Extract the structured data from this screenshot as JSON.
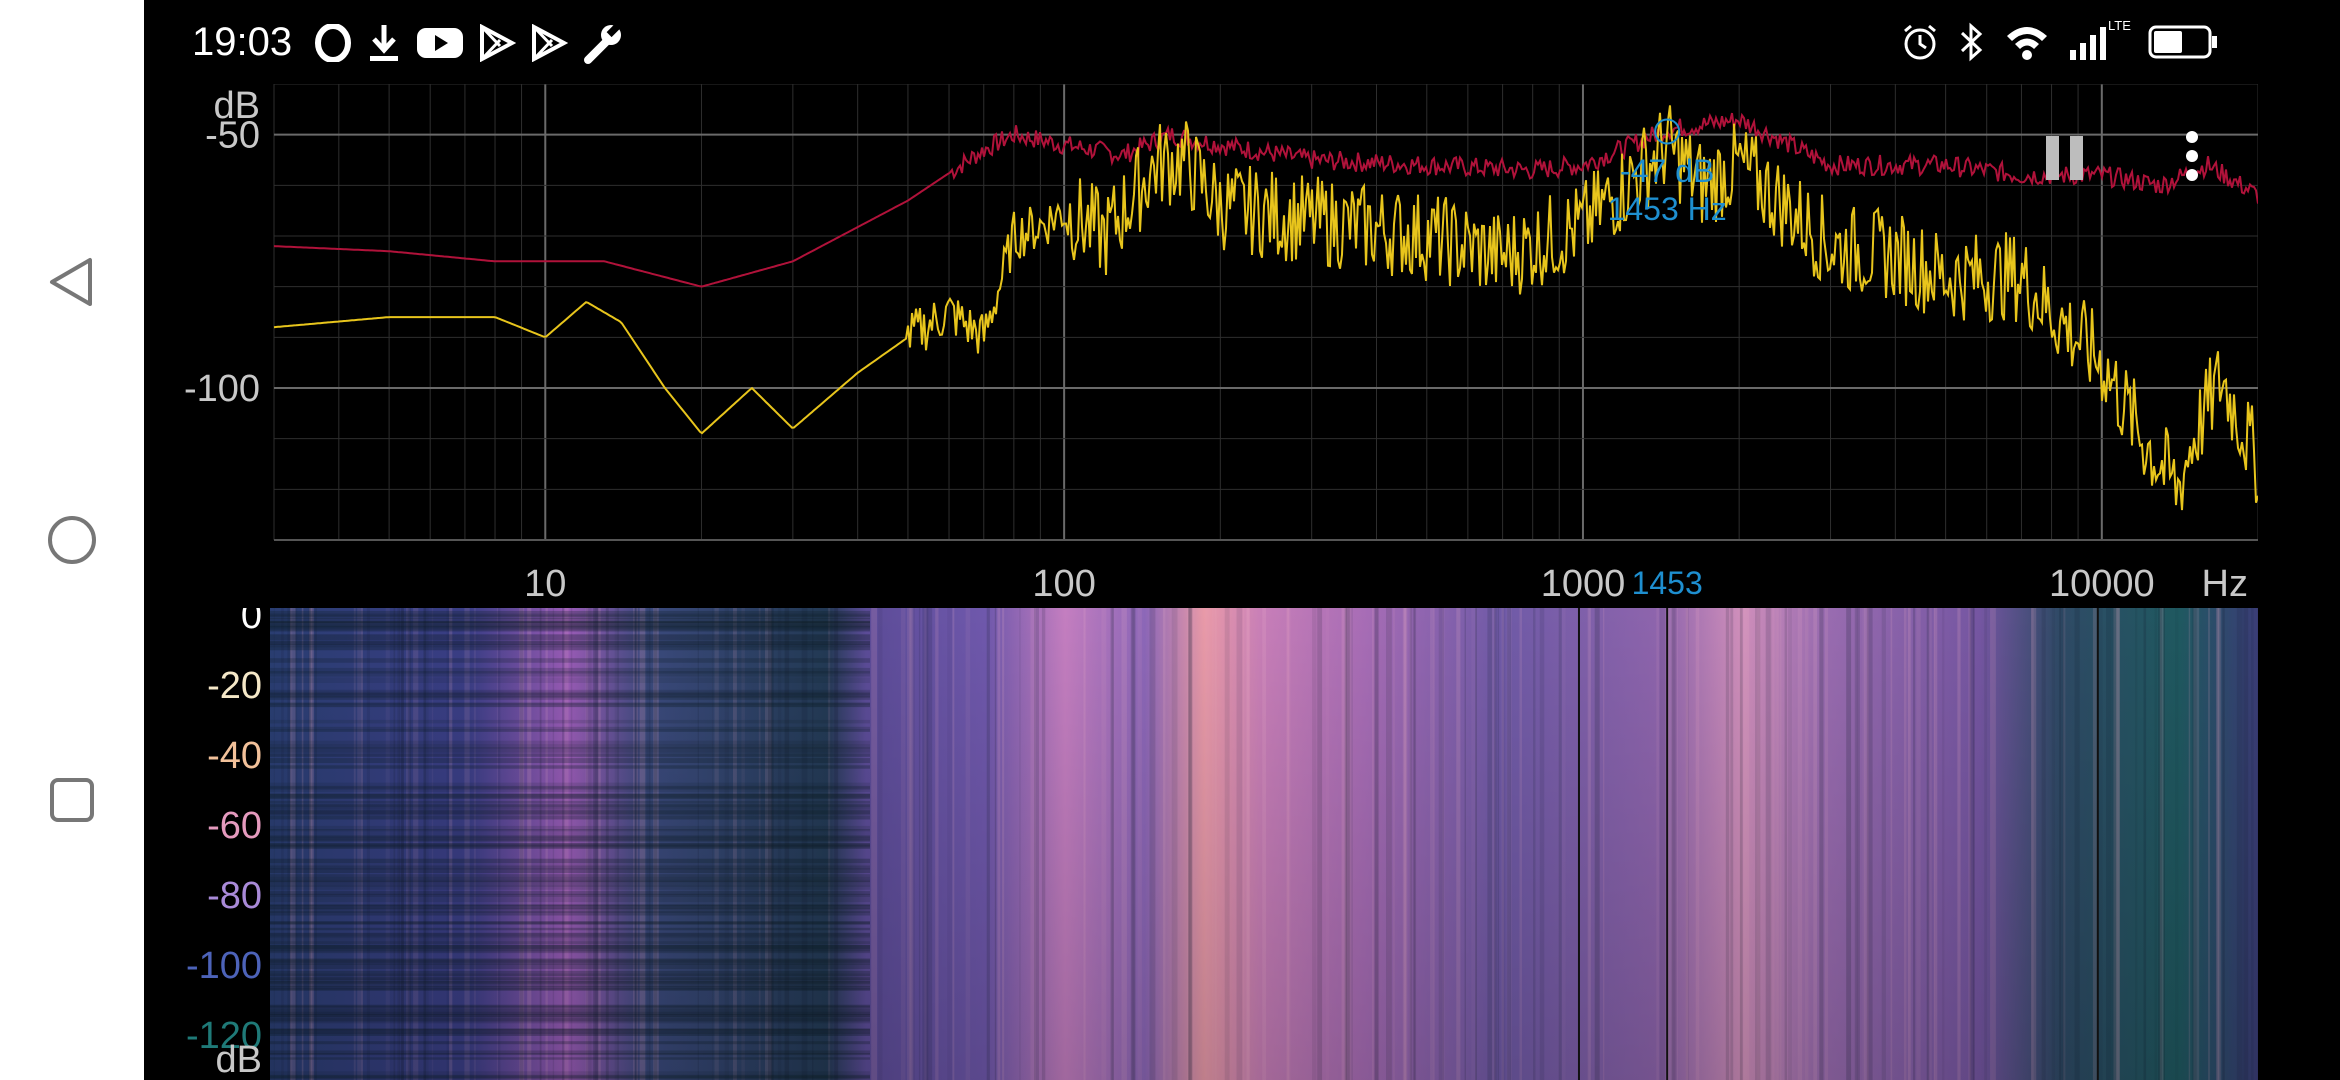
{
  "status_bar": {
    "time": "19:03",
    "left_icons": [
      "opera-icon",
      "download-icon",
      "youtube-icon",
      "play-store-icon",
      "play-store-icon",
      "wrench-icon"
    ],
    "right_icons": [
      "alarm-icon",
      "bluetooth-icon",
      "wifi-icon",
      "cell-signal-icon",
      "battery-icon"
    ],
    "network_type": "LTE"
  },
  "nav_bar": {
    "buttons": [
      "back",
      "home",
      "recents"
    ]
  },
  "spectrum": {
    "y_unit": "dB",
    "x_unit": "Hz",
    "y_ticks": [
      "-50",
      "-100"
    ],
    "x_ticks": [
      "10",
      "100",
      "1000",
      "10000"
    ],
    "cursor": {
      "db_label": "-47 dB",
      "hz_label": "1453 Hz",
      "x_marker_label": "1453"
    },
    "colors": {
      "peak_hold": "#b0123a",
      "live": "#e8c51c",
      "cursor": "#1e8fd0"
    }
  },
  "spectrogram": {
    "y_unit": "dB",
    "y_ticks": [
      "0",
      "-20",
      "-40",
      "-60",
      "-80",
      "-100",
      "-120"
    ],
    "y_tick_colors": [
      "#ffffff",
      "#f5e8c8",
      "#f2c19a",
      "#e59abe",
      "#a98ad8",
      "#4d63b9",
      "#1f7a78"
    ]
  },
  "chart_data": {
    "type": "line",
    "xlabel": "Hz",
    "ylabel": "dB",
    "x_scale": "log",
    "xlim": [
      3,
      20000
    ],
    "ylim": [
      -130,
      -40
    ],
    "series": [
      {
        "x": [
          3,
          5,
          8,
          10,
          13,
          20,
          30,
          50,
          70,
          80,
          100,
          130,
          160,
          200,
          300,
          500,
          800,
          1000,
          1453,
          2000,
          3000,
          5000,
          7000,
          10000,
          13000,
          16000,
          20000
        ],
        "values": [
          -72,
          -73,
          -75,
          -75,
          -75,
          -80,
          -75,
          -63,
          -53,
          -50,
          -52,
          -54,
          -50,
          -52,
          -55,
          -56,
          -57,
          -56,
          -49,
          -47,
          -56,
          -56,
          -58,
          -58,
          -60,
          -56,
          -62
        ]
      },
      {
        "x": [
          3,
          5,
          8,
          10,
          12,
          14,
          17,
          20,
          25,
          30,
          40,
          50,
          60,
          70,
          75,
          80,
          90,
          100,
          120,
          150,
          170,
          200,
          300,
          500,
          700,
          1000,
          1453,
          1700,
          2000,
          3000,
          4000,
          5000,
          7000,
          8000,
          10000,
          12000,
          14000,
          15000,
          17000,
          20000
        ],
        "values": [
          -88,
          -86,
          -86,
          -90,
          -83,
          -87,
          -100,
          -109,
          -100,
          -108,
          -97,
          -90,
          -85,
          -90,
          -80,
          -70,
          -68,
          -65,
          -70,
          -56,
          -55,
          -64,
          -67,
          -70,
          -74,
          -68,
          -52,
          -60,
          -56,
          -72,
          -74,
          -78,
          -78,
          -85,
          -95,
          -110,
          -120,
          -110,
          -98,
          -115
        ]
      }
    ]
  }
}
